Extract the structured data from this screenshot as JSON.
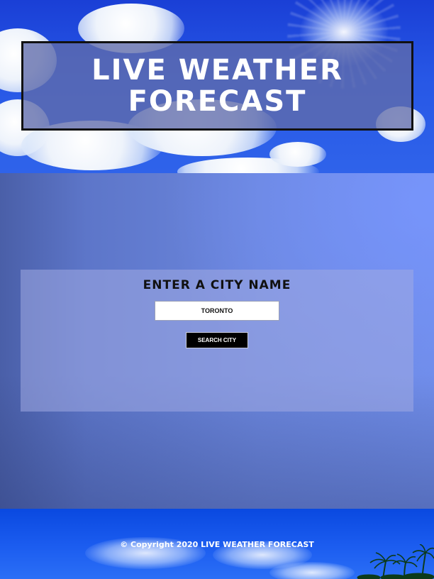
{
  "header": {
    "title": "LIVE WEATHER FORECAST"
  },
  "search": {
    "heading": "ENTER A CITY NAME",
    "input_value": "TORONTO",
    "placeholder": "",
    "button_label": "SEARCH CITY"
  },
  "footer": {
    "copyright": "© Copyright 2020 LIVE WEATHER FORECAST"
  },
  "colors": {
    "sky_blue": "#2757e6",
    "main_blue": "#6b86dd",
    "button_black": "#000000",
    "title_text": "#ffffff"
  },
  "icons": [
    "palm-trees-image",
    "sun-image",
    "cloud-image"
  ]
}
